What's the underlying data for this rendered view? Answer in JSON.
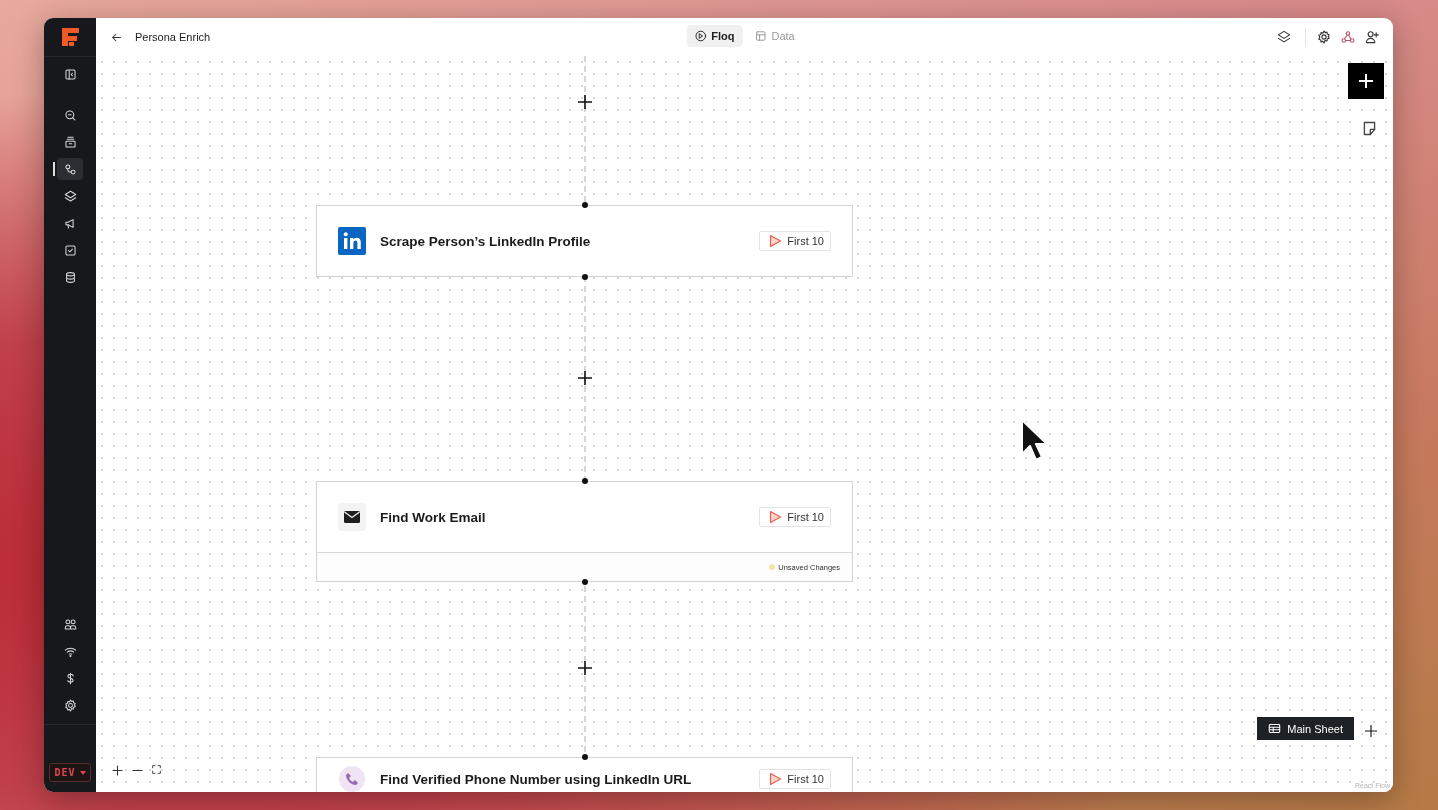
{
  "app": {
    "title": "Persona Enrich"
  },
  "view_tabs": [
    {
      "label": "Floq",
      "selected": true
    },
    {
      "label": "Data",
      "selected": false
    }
  ],
  "sidebar": {
    "top_items": [
      {
        "selected": false
      },
      {
        "selected": false
      },
      {
        "selected": false
      },
      {
        "selected": true
      },
      {
        "selected": false
      },
      {
        "selected": false
      },
      {
        "selected": false
      },
      {
        "selected": false
      }
    ],
    "bottom_items": [
      {
        "selected": false
      },
      {
        "selected": false
      },
      {
        "selected": false
      },
      {
        "selected": false
      }
    ],
    "environment": "DEV"
  },
  "nodes": [
    {
      "kind": "linkedin",
      "title": "Scrape Person’s LinkedIn Profile",
      "run_label": "First 10"
    },
    {
      "kind": "email",
      "title": "Find Work Email",
      "run_label": "First 10",
      "status": "Unsaved Changes"
    },
    {
      "kind": "phone",
      "title": "Find Verified Phone Number using LinkedIn URL",
      "run_label": "First 10"
    }
  ],
  "sheet_tabs": [
    {
      "label": "Main Sheet",
      "selected": true
    }
  ],
  "attribution": "React Flow"
}
